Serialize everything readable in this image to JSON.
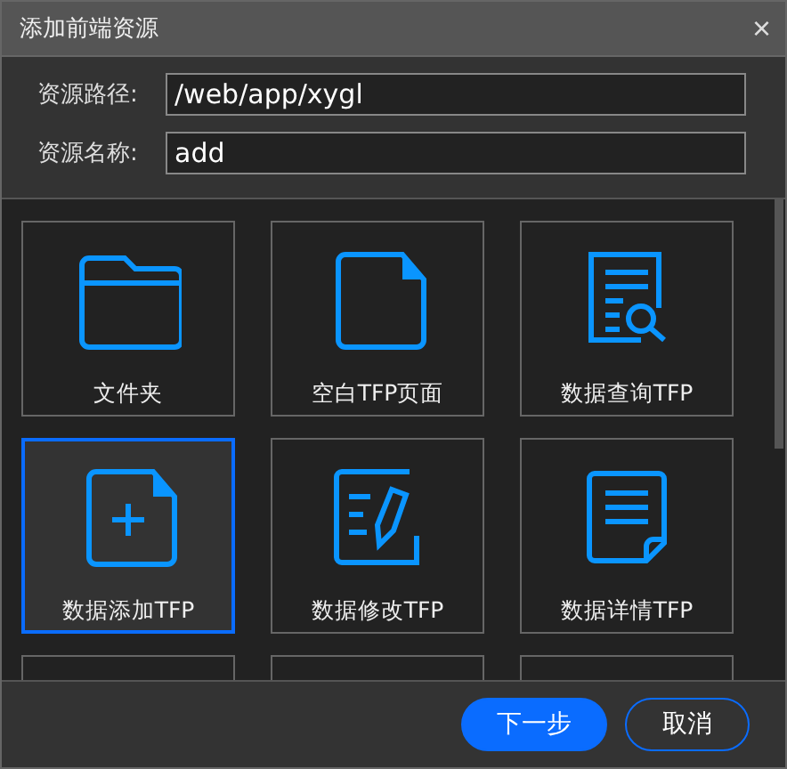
{
  "window": {
    "title": "添加前端资源",
    "close": "×"
  },
  "fields": [
    {
      "label": "资源路径:",
      "value": "/web/app/xygl"
    },
    {
      "label": "资源名称:",
      "value": "add"
    }
  ],
  "tiles": [
    {
      "kind": "folder",
      "label": "文件夹",
      "selected": false
    },
    {
      "kind": "blank",
      "label": "空白TFP页面",
      "selected": false
    },
    {
      "kind": "query",
      "label": "数据查询TFP",
      "selected": false
    },
    {
      "kind": "add",
      "label": "数据添加TFP",
      "selected": true
    },
    {
      "kind": "edit",
      "label": "数据修改TFP",
      "selected": false
    },
    {
      "kind": "detail",
      "label": "数据详情TFP",
      "selected": false
    },
    {
      "kind": "hidden",
      "selected": false
    },
    {
      "kind": "hidden",
      "selected": false
    },
    {
      "kind": "hidden",
      "selected": false
    }
  ],
  "buttons": [
    {
      "label": "下一步",
      "kind": "primary"
    },
    {
      "label": "取消",
      "kind": "secondary"
    }
  ]
}
